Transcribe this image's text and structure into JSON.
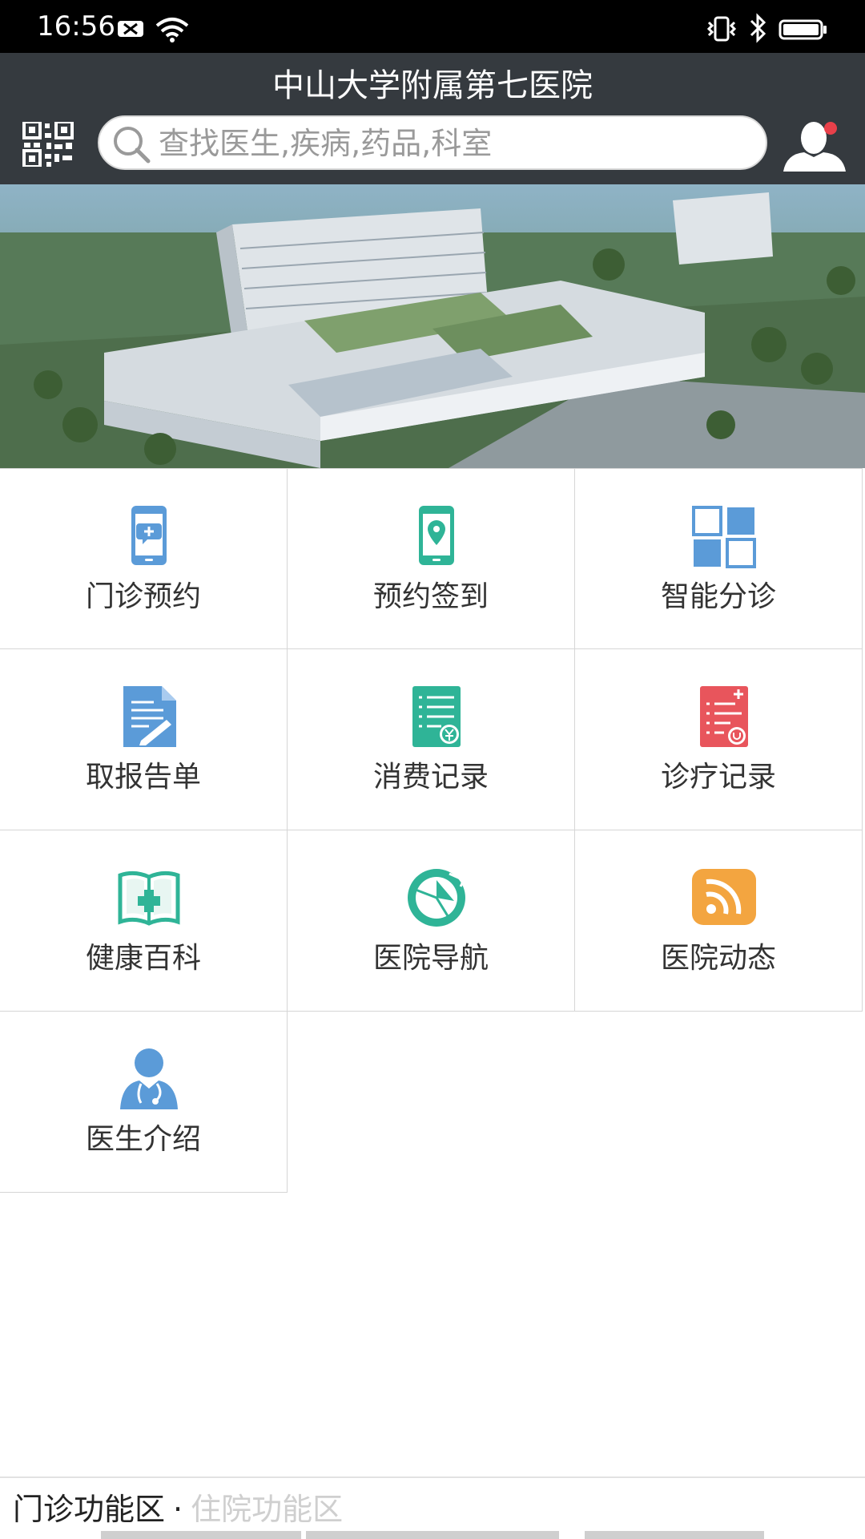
{
  "status_bar": {
    "time": "16:56"
  },
  "header": {
    "title": "中山大学附属第七医院",
    "search_placeholder": "查找医生,疾病,药品,科室"
  },
  "menu": {
    "items": [
      {
        "label": "门诊预约",
        "icon": "phone-chat-icon"
      },
      {
        "label": "预约签到",
        "icon": "phone-location-icon"
      },
      {
        "label": "智能分诊",
        "icon": "grid-squares-icon"
      },
      {
        "label": "取报告单",
        "icon": "report-document-icon"
      },
      {
        "label": "消费记录",
        "icon": "expense-list-icon"
      },
      {
        "label": "诊疗记录",
        "icon": "medical-record-icon"
      },
      {
        "label": "健康百科",
        "icon": "health-book-icon"
      },
      {
        "label": "医院导航",
        "icon": "compass-icon"
      },
      {
        "label": "医院动态",
        "icon": "rss-feed-icon"
      },
      {
        "label": "医生介绍",
        "icon": "doctor-icon"
      }
    ]
  },
  "bottom_tabs": {
    "active": "门诊功能区",
    "separator": "·",
    "inactive": "住院功能区"
  },
  "colors": {
    "header_bg": "#353a3f",
    "blue_icon": "#5b9bd8",
    "green_icon": "#2fb497",
    "red_icon": "#e8555c",
    "orange_icon": "#f3a540"
  }
}
